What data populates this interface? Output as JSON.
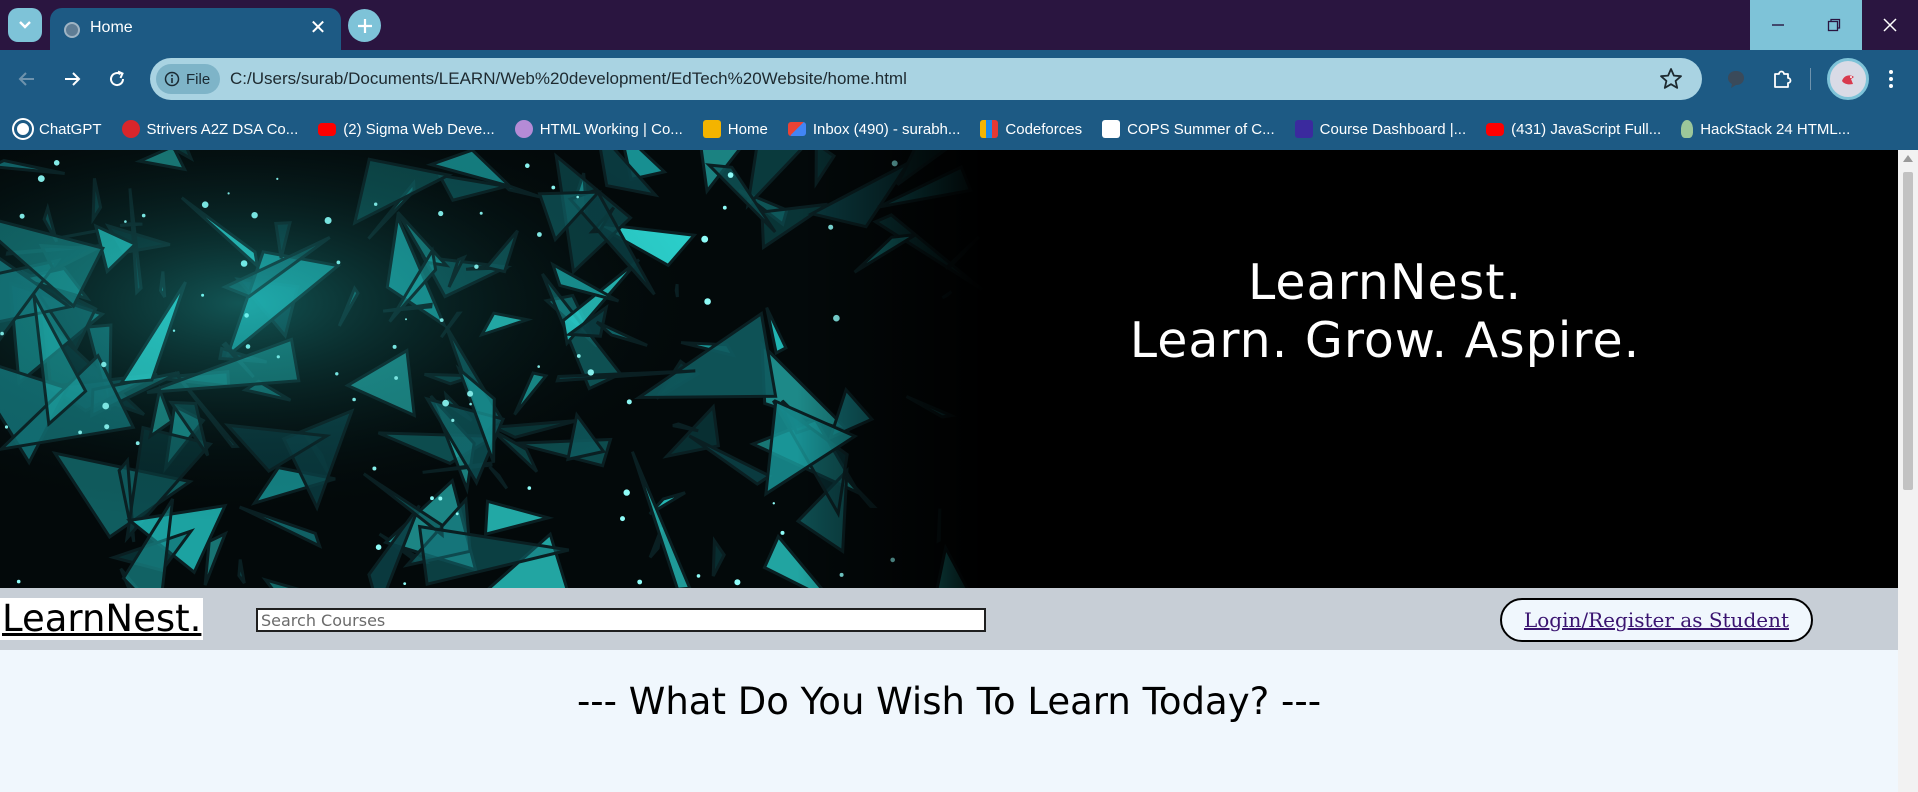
{
  "browser": {
    "tab": {
      "title": "Home",
      "close": "✕"
    },
    "url_chip": "File",
    "url": "C:/Users/surab/Documents/LEARN/Web%20development/EdTech%20Website/home.html"
  },
  "bookmarks": [
    {
      "label": "ChatGPT",
      "icon": "chatgpt-icon",
      "color": "#ffffff"
    },
    {
      "label": "Strivers A2Z DSA Co...",
      "icon": "tuf-icon",
      "color": "#d9262b"
    },
    {
      "label": "(2) Sigma Web Deve...",
      "icon": "youtube-icon",
      "color": "#ff0000"
    },
    {
      "label": "HTML Working | Co...",
      "icon": "avatar-icon",
      "color": "#b58bd6"
    },
    {
      "label": "Home",
      "icon": "classroom-icon",
      "color": "#f4b400"
    },
    {
      "label": "Inbox (490) - surabh...",
      "icon": "gmail-icon",
      "color": "#ea4335"
    },
    {
      "label": "Codeforces",
      "icon": "codeforces-icon",
      "color": "#1e88e5"
    },
    {
      "label": "COPS Summer of C...",
      "icon": "cops-icon",
      "color": "#ffffff"
    },
    {
      "label": "Course Dashboard |...",
      "icon": "dashboard-icon",
      "color": "#3b2a9e"
    },
    {
      "label": "(431) JavaScript Full...",
      "icon": "youtube-icon",
      "color": "#ff0000"
    },
    {
      "label": "HackStack 24 HTML...",
      "icon": "hackstack-icon",
      "color": "#9cc79a"
    }
  ],
  "hero": {
    "line1": "LearnNest.",
    "line2": "Learn. Grow. Aspire."
  },
  "navbar": {
    "logo": "LearnNest.",
    "search_placeholder": "Search Courses",
    "login_label": "Login/Register as Student"
  },
  "main": {
    "headline": "--- What Do You Wish To Learn Today? ---"
  },
  "colors": {
    "accent": "#7ec3d8",
    "toolbar": "#1d5a84",
    "titlebar": "#2a1540",
    "hero_crystal": "#1fb3b3"
  }
}
